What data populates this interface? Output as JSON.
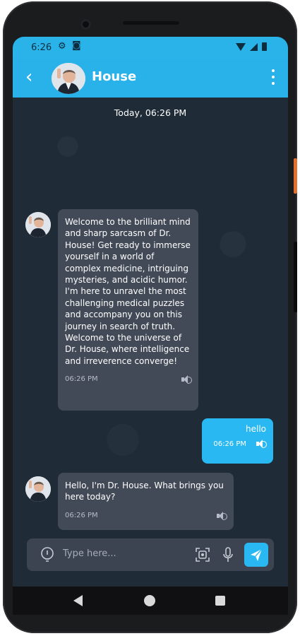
{
  "status": {
    "time": "6:26",
    "icons": [
      "gear-icon",
      "cast-icon",
      "wifi-icon",
      "signal-icon",
      "battery-icon"
    ]
  },
  "header": {
    "title": "House",
    "back_icon": "back-arrow-icon",
    "menu_icon": "more-vert-icon"
  },
  "chat": {
    "date_separator": "Today, 06:26 PM",
    "messages": [
      {
        "direction": "incoming",
        "text": "Welcome to the brilliant mind and sharp sarcasm of Dr. House! Get ready to immerse yourself in a world of complex medicine, intriguing mysteries, and acidic humor. I'm here to unravel the most challenging medical puzzles and accompany you on this journey in search of truth. Welcome to the universe of Dr. House, where intelligence and irreverence converge!",
        "time": "06:26 PM"
      },
      {
        "direction": "outgoing",
        "text": "hello",
        "time": "06:26 PM"
      },
      {
        "direction": "incoming",
        "text": "Hello, I'm Dr. House. What brings you here today?",
        "time": "06:26 PM"
      }
    ]
  },
  "composer": {
    "placeholder": "Type here..."
  },
  "colors": {
    "accent": "#2ab8f2",
    "background": "#1f2b37",
    "incoming_bubble": "#434a57",
    "composer": "#3c4451"
  }
}
